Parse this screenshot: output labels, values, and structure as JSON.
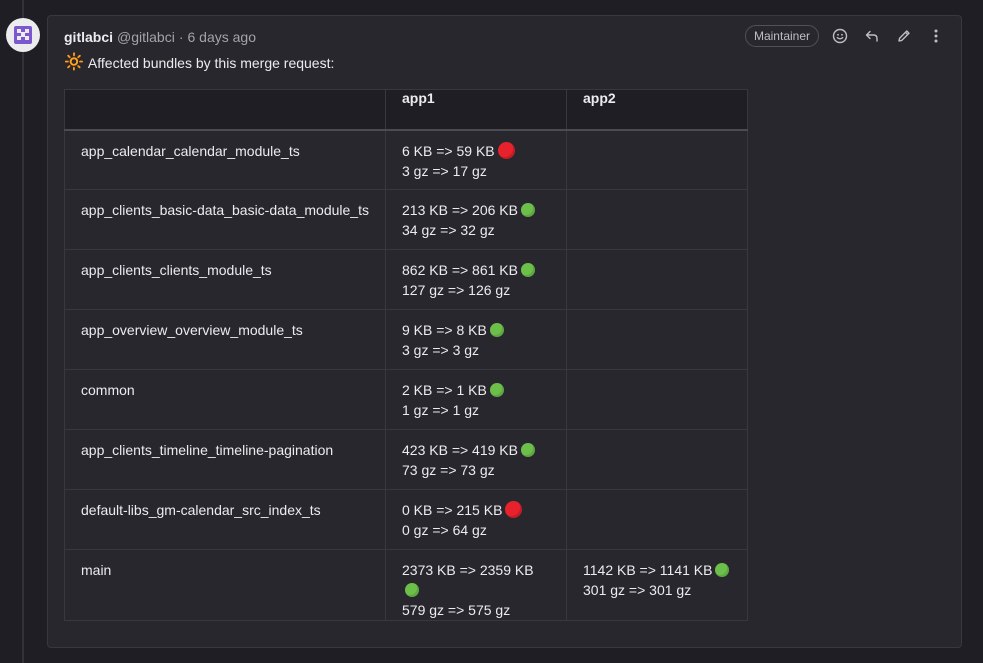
{
  "note": {
    "author_name": "gitlabci",
    "author_handle": "@gitlabci",
    "separator": "·",
    "time_ago": "6 days ago",
    "role": "Maintainer",
    "body_emoji": "🔆",
    "body_text": "Affected bundles by this merge request:"
  },
  "icons": [
    "avatar",
    "smiley-icon",
    "reply-icon",
    "pencil-icon",
    "more-vertical-icon",
    "red-circle-icon",
    "green-circle-icon"
  ],
  "colors": {
    "red_status": "#e8222d",
    "green_status": "#6cc04a",
    "background": "#1f1e24",
    "card": "#28272d"
  },
  "table": {
    "headers": [
      "",
      "app1",
      "app2"
    ],
    "rows": [
      {
        "name": "app_calendar_calendar_module_ts",
        "app1": {
          "size": "6 KB => 59 KB",
          "gz": "3 gz => 17 gz",
          "status": "red"
        },
        "app2": null
      },
      {
        "name": "app_clients_basic-data_basic-data_module_ts",
        "app1": {
          "size": "213 KB => 206 KB",
          "gz": "34 gz => 32 gz",
          "status": "green"
        },
        "app2": null
      },
      {
        "name": "app_clients_clients_module_ts",
        "app1": {
          "size": "862 KB => 861 KB",
          "gz": "127 gz => 126 gz",
          "status": "green"
        },
        "app2": null
      },
      {
        "name": "app_overview_overview_module_ts",
        "app1": {
          "size": "9 KB => 8 KB",
          "gz": "3 gz => 3 gz",
          "status": "green"
        },
        "app2": null
      },
      {
        "name": "common",
        "app1": {
          "size": "2 KB => 1 KB",
          "gz": "1 gz => 1 gz",
          "status": "green"
        },
        "app2": null
      },
      {
        "name": "app_clients_timeline_timeline-pagination",
        "app1": {
          "size": "423 KB => 419 KB",
          "gz": "73 gz => 73 gz",
          "status": "green"
        },
        "app2": null
      },
      {
        "name": "default-libs_gm-calendar_src_index_ts",
        "app1": {
          "size": "0 KB => 215 KB",
          "gz": "0 gz => 64 gz",
          "status": "red"
        },
        "app2": null
      },
      {
        "name": "main",
        "app1": {
          "size": "2373 KB => 2359 KB",
          "gz": "579 gz => 575 gz",
          "status": "green"
        },
        "app2": {
          "size": "1142 KB => 1141 KB",
          "gz": "301 gz => 301 gz",
          "status": "green"
        }
      }
    ]
  }
}
